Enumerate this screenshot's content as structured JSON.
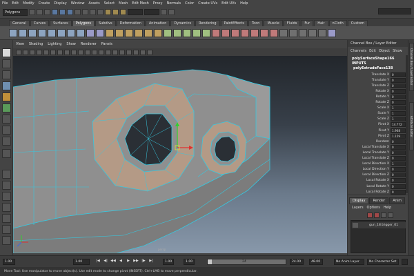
{
  "menubar": {
    "items": [
      "File",
      "Edit",
      "Modify",
      "Create",
      "Display",
      "Window",
      "Assets",
      "Select",
      "Mesh",
      "Edit Mesh",
      "Proxy",
      "Normals",
      "Color",
      "Create UVs",
      "Edit UVs",
      "Help"
    ]
  },
  "statusline": {
    "mode": "Polygons"
  },
  "shelf": {
    "tabs": [
      "General",
      "Curves",
      "Surfaces",
      "Polygons",
      "Subdivs",
      "Deformation",
      "Animation",
      "Dynamics",
      "Rendering",
      "PaintEffects",
      "Toon",
      "Muscle",
      "Fluids",
      "Fur",
      "Hair",
      "nCloth",
      "Custom"
    ],
    "active_tab": "Polygons"
  },
  "viewport": {
    "menu": [
      "View",
      "Shading",
      "Lighting",
      "Show",
      "Renderer",
      "Panels"
    ],
    "camera_label": "persp"
  },
  "channel_box": {
    "title": "Channel Box / Layer Editor",
    "menu": [
      "Channels",
      "Edit",
      "Object",
      "Show"
    ],
    "shape_name": "polySurfaceShape166",
    "inputs_label": "INPUTS",
    "node_name": "polyExtrudeFace138",
    "attributes": [
      {
        "name": "Translate X",
        "value": "0"
      },
      {
        "name": "Translate Y",
        "value": "0"
      },
      {
        "name": "Translate Z",
        "value": "0"
      },
      {
        "name": "Rotate X",
        "value": "0"
      },
      {
        "name": "Rotate Y",
        "value": "0"
      },
      {
        "name": "Rotate Z",
        "value": "0"
      },
      {
        "name": "Scale X",
        "value": "1"
      },
      {
        "name": "Scale Y",
        "value": "1"
      },
      {
        "name": "Scale Z",
        "value": "1"
      },
      {
        "name": "Pivot X",
        "value": "14.772"
      },
      {
        "name": "Pivot Y",
        "value": "1.968"
      },
      {
        "name": "Pivot Z",
        "value": "1.159"
      },
      {
        "name": "Random",
        "value": "0"
      },
      {
        "name": "Local Translate X",
        "value": "0"
      },
      {
        "name": "Local Translate Y",
        "value": "0"
      },
      {
        "name": "Local Translate Z",
        "value": "0"
      },
      {
        "name": "Local Direction X",
        "value": "1"
      },
      {
        "name": "Local Direction Y",
        "value": "0"
      },
      {
        "name": "Local Direction Z",
        "value": "0"
      },
      {
        "name": "Local Rotate X",
        "value": "0"
      },
      {
        "name": "Local Rotate Y",
        "value": "0"
      },
      {
        "name": "Local Rotate Z",
        "value": "0"
      }
    ]
  },
  "side_tabs": [
    "Attribute Editor",
    "Channel Box / Layer Editor"
  ],
  "layer_editor": {
    "tabs": [
      "Display",
      "Render",
      "Anim"
    ],
    "active_tab": "Display",
    "menu": [
      "Layers",
      "Options",
      "Help"
    ],
    "layers": [
      {
        "name": "gun_18:trigger_01"
      }
    ]
  },
  "timebar": {
    "start_field": "1.00",
    "current_field": "1.00",
    "current_frame": "1",
    "range_start_a": "1.00",
    "range_start_b": "1.00",
    "range_slider_label": "24",
    "range_end": "24.00",
    "anim_end": "48.00",
    "anim_layer": "No Anim Layer",
    "character_set": "No Character Set",
    "playback_buttons": [
      "|◀",
      "◀|",
      "◀◀",
      "◀",
      "▶",
      "▶▶",
      "|▶",
      "▶|"
    ]
  },
  "helpline": "Move Tool: Use manipulator to move object(s). Use edit mode to change pivot (INSERT). Ctrl+LMB to move perpendicular.",
  "colors": {
    "selected_face": "#b49a86",
    "wire": "#36c8e0",
    "mesh_gray": "#8f8f8f"
  }
}
